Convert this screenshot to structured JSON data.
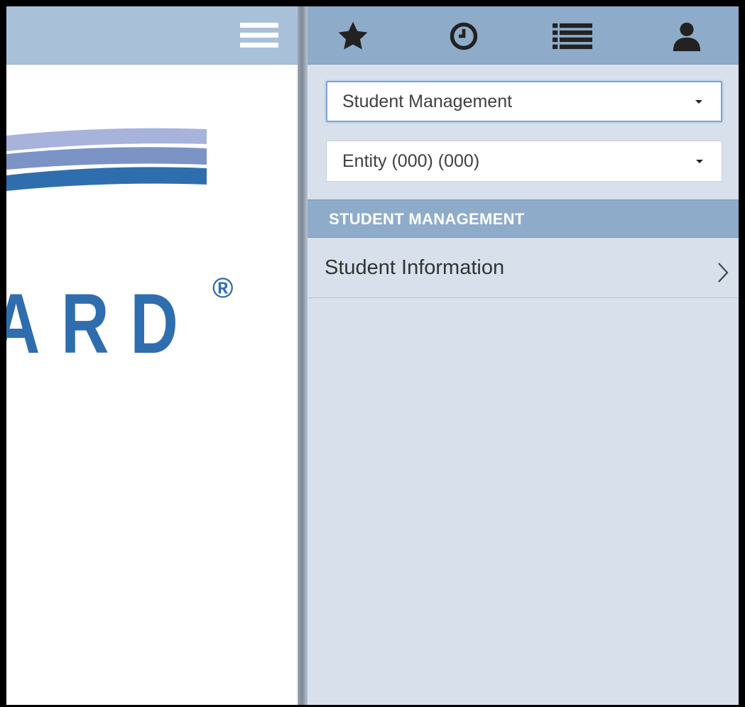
{
  "left_header": {
    "menu_icon": "hamburger-icon"
  },
  "logo": {
    "visible_text": "ARD",
    "registered_mark": "®",
    "colors": [
      "#a7b3db",
      "#7c93c6",
      "#2f6eae"
    ]
  },
  "toolbar": {
    "icons": [
      "star-icon",
      "clock-icon",
      "list-icon",
      "user-icon"
    ]
  },
  "selects": {
    "module": {
      "value": "Student Management"
    },
    "entity": {
      "value": "Entity (000) (000)"
    }
  },
  "section": {
    "title": "STUDENT MANAGEMENT"
  },
  "menu": {
    "items": [
      {
        "label": "Student Information",
        "icon": "chevron-right-icon"
      }
    ]
  },
  "colors": {
    "left_header_bg": "#a9c0d9",
    "toolbar_bg": "#8eacca",
    "panel_bg": "#d7e0eb",
    "logo_blue": "#2f6eae"
  }
}
